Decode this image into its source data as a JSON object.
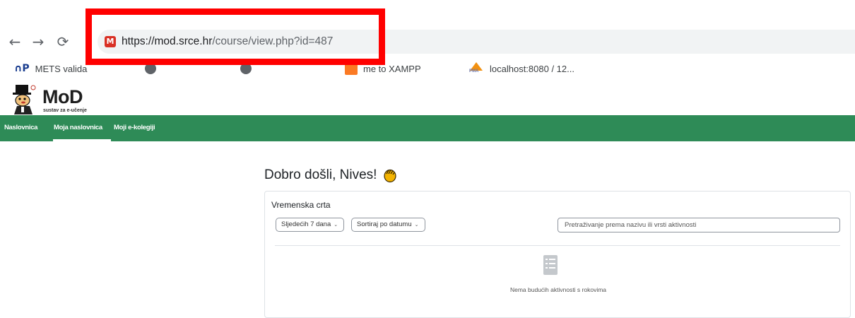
{
  "browser": {
    "url_host": "https://mod.srce.hr",
    "url_path": "/course/view.php?id=487",
    "bookmarks": [
      {
        "label": "METS valida",
        "icon": "up-logo-icon"
      },
      {
        "label": "me to XAMPP",
        "icon": "xampp-icon"
      },
      {
        "label": "localhost:8080 / 12...",
        "icon": "phpmyadmin-icon"
      }
    ]
  },
  "site": {
    "brand": "MoD",
    "tagline": "sustav za e-učenje"
  },
  "nav": {
    "items": [
      "Naslovnica",
      "Moja naslovnica",
      "Moji e-kolegiji"
    ],
    "active": "Moja naslovnica"
  },
  "main": {
    "welcome": "Dobro došli, Nives!",
    "timeline": {
      "title": "Vremenska crta",
      "filter": "Sljedećih 7 dana",
      "sort": "Sortiraj po datumu",
      "search_placeholder": "Pretraživanje prema nazivu ili vrsti aktivnosti",
      "empty": "Nema budućih aktivnosti s rokovima"
    }
  },
  "colors": {
    "nav_green": "#2e8b57",
    "annotation_red": "#ff0000"
  }
}
